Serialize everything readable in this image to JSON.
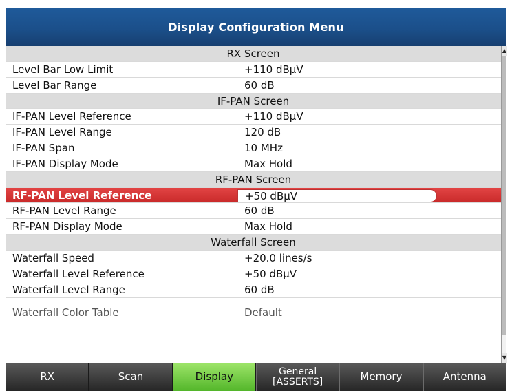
{
  "title": "Display Configuration Menu",
  "rows": [
    {
      "type": "header",
      "label": "RX Screen"
    },
    {
      "type": "item",
      "label": "Level Bar Low Limit",
      "value": "+110 dBµV"
    },
    {
      "type": "item",
      "label": "Level Bar Range",
      "value": "60 dB"
    },
    {
      "type": "header",
      "label": "IF-PAN Screen"
    },
    {
      "type": "item",
      "label": "IF-PAN Level Reference",
      "value": "+110 dBµV"
    },
    {
      "type": "item",
      "label": "IF-PAN Level Range",
      "value": "120 dB"
    },
    {
      "type": "item",
      "label": "IF-PAN Span",
      "value": "10 MHz"
    },
    {
      "type": "item",
      "label": "IF-PAN Display Mode",
      "value": "Max Hold"
    },
    {
      "type": "header",
      "label": "RF-PAN Screen"
    },
    {
      "type": "item",
      "label": "RF-PAN Level Reference",
      "value": "+50 dBµV",
      "selected": true
    },
    {
      "type": "item",
      "label": "RF-PAN Level Range",
      "value": "60 dB"
    },
    {
      "type": "item",
      "label": "RF-PAN Display Mode",
      "value": "Max Hold"
    },
    {
      "type": "header",
      "label": "Waterfall Screen"
    },
    {
      "type": "item",
      "label": "Waterfall Speed",
      "value": "+20.0 lines/s"
    },
    {
      "type": "item",
      "label": "Waterfall Level Reference",
      "value": "+50 dBµV"
    },
    {
      "type": "item",
      "label": "Waterfall Level Range",
      "value": "60 dB"
    },
    {
      "type": "partial",
      "label": "Waterfall Color Table",
      "value": "Default"
    }
  ],
  "softkeys": [
    {
      "label": "RX"
    },
    {
      "label": "Scan"
    },
    {
      "label": "Display",
      "active": true
    },
    {
      "label": "General\n[ASSERTS]"
    },
    {
      "label": "Memory"
    },
    {
      "label": "Antenna"
    }
  ],
  "scrollbar": {
    "up_icon": "triangle-up",
    "down_icon": "triangle-down"
  }
}
